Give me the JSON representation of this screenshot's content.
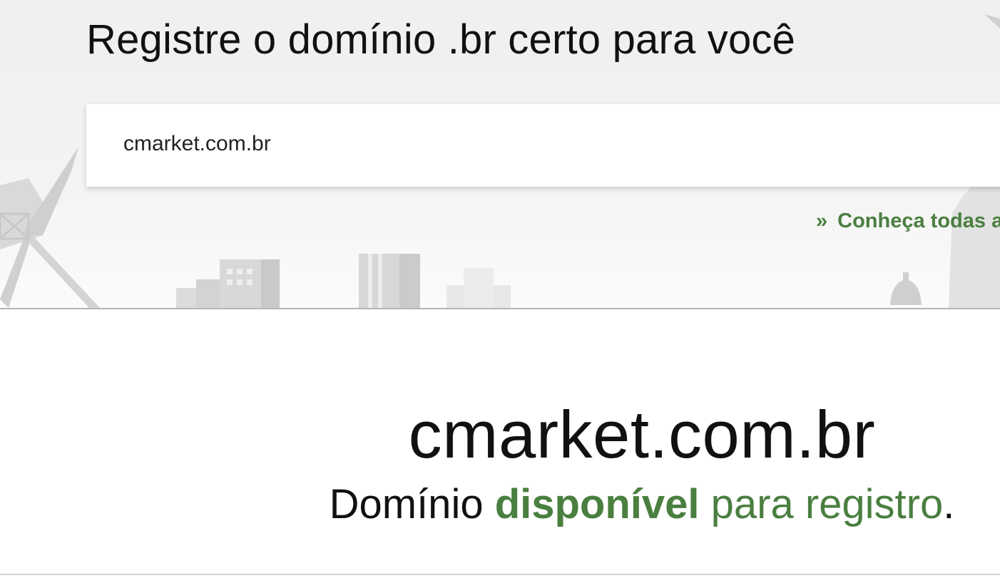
{
  "hero": {
    "title": "Registre o domínio .br certo para você"
  },
  "search": {
    "value": "cmarket.com.br",
    "placeholder": ""
  },
  "links": {
    "conheca_chevron": "»",
    "conheca_label": "Conheça todas a"
  },
  "result": {
    "domain": "cmarket.com.br",
    "status_prefix": "Domínio ",
    "status_strong": "disponível",
    "status_middle": " para registro",
    "status_end": "."
  },
  "colors": {
    "accent_green": "#4a7f3f",
    "text_dark": "#111111",
    "hero_background": "#f0f0f0"
  }
}
